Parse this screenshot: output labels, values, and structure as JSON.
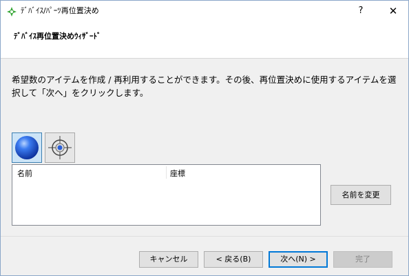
{
  "window": {
    "title": "ﾃﾞﾊﾞｲｽ/ﾊﾟｰﾂ再位置決め",
    "help_label": "?",
    "close_label": "✕"
  },
  "header": {
    "title": "ﾃﾞﾊﾞｲｽ再位置決めｳｨｻﾞｰﾄﾞ"
  },
  "description": "希望数のアイテムを作成 / 再利用することができます。その後、再位置決めに使用するアイテムを選択して「次へ」をクリックします。",
  "toolbar": {
    "items": [
      {
        "icon": "blue-sphere-icon",
        "selected": true
      },
      {
        "icon": "crosshair-target-icon",
        "selected": false
      }
    ]
  },
  "list": {
    "columns": [
      "名前",
      "座標"
    ],
    "rows": []
  },
  "buttons": {
    "rename": "名前を変更",
    "cancel": "キャンセル",
    "back": "< 戻る(B)",
    "next": "次へ(N) >",
    "finish": "完了"
  },
  "colors": {
    "accent": "#0078d7",
    "selected_tool_bg": "#cce4f7",
    "sphere": "#1f5fe0"
  }
}
